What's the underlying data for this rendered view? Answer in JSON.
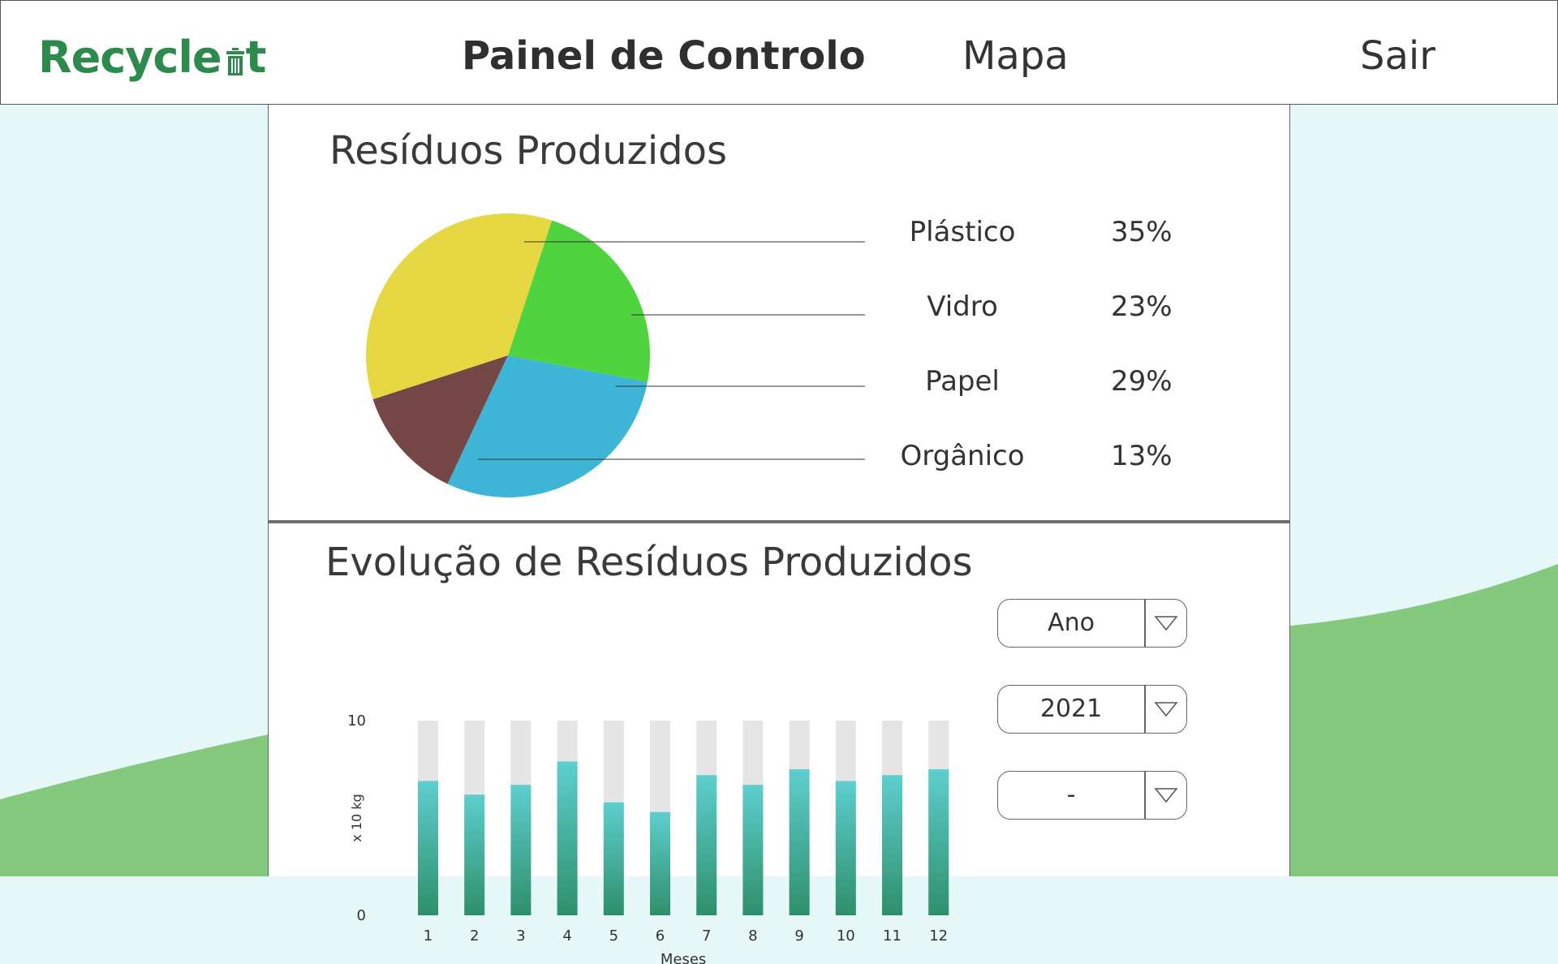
{
  "header": {
    "logo_text_part1": "Recycle",
    "logo_text_part2": "t",
    "nav": {
      "dashboard": "Painel de Controlo",
      "map": "Mapa",
      "exit": "Sair"
    }
  },
  "colors": {
    "brand_green": "#2b8a4c",
    "background_mint": "#e6f8f8",
    "background_hill": "#84c97e",
    "bar_top": "#5ecfcf",
    "bar_bottom": "#2e8f6a",
    "bar_track": "#e6e6e6"
  },
  "icons": {
    "logo_mark": "trash-bin-icon",
    "dropdown_arrow": "chevron-down-triangle-icon"
  },
  "sections": {
    "waste_produced": "Resíduos Produzidos",
    "waste_evolution": "Evolução de Resíduos Produzidos"
  },
  "filters": [
    {
      "value": "Ano"
    },
    {
      "value": "2021"
    },
    {
      "value": "-"
    }
  ],
  "chart_data": [
    {
      "type": "pie",
      "title": "Resíduos Produzidos",
      "slices": [
        {
          "label": "Plástico",
          "value": 35,
          "display": "35%",
          "color": "#e6d843"
        },
        {
          "label": "Vidro",
          "value": 23,
          "display": "23%",
          "color": "#4fd43f"
        },
        {
          "label": "Papel",
          "value": 29,
          "display": "29%",
          "color": "#3eb5d6"
        },
        {
          "label": "Orgânico",
          "value": 13,
          "display": "13%",
          "color": "#744646"
        }
      ]
    },
    {
      "type": "bar",
      "title": "Evolução de Resíduos Produzidos",
      "xlabel": "Meses",
      "ylabel": "x 10 kg",
      "ylim": [
        0,
        10
      ],
      "yticks": [
        "0",
        "10"
      ],
      "categories": [
        "1",
        "2",
        "3",
        "4",
        "5",
        "6",
        "7",
        "8",
        "9",
        "10",
        "11",
        "12"
      ],
      "values": [
        6.9,
        6.2,
        6.7,
        7.9,
        5.8,
        5.3,
        7.2,
        6.7,
        7.5,
        6.9,
        7.2,
        7.5
      ]
    }
  ]
}
